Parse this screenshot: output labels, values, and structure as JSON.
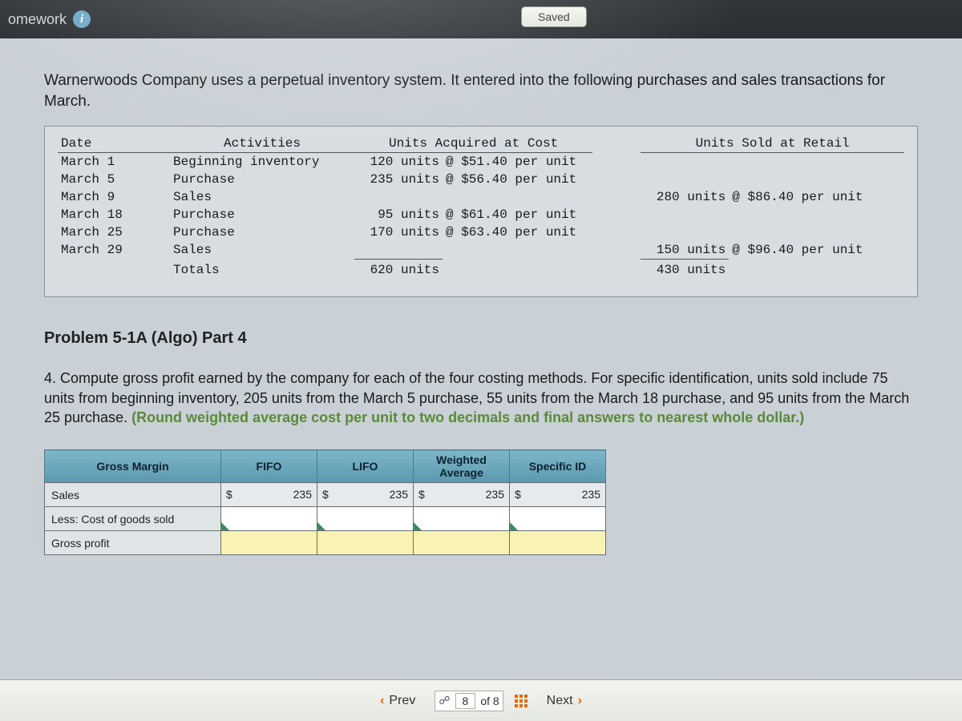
{
  "topbar": {
    "title": "omework",
    "saved": "Saved"
  },
  "intro": "Warnerwoods Company uses a perpetual inventory system. It entered into the following purchases and sales transactions for March.",
  "headers": {
    "date": "Date",
    "activities": "Activities",
    "acquired": "Units Acquired at Cost",
    "sold": "Units Sold at Retail"
  },
  "rows": [
    {
      "date": "March 1",
      "act": "Beginning inventory",
      "acq_units": "120 units",
      "acq_rate": "@ $51.40 per unit",
      "sold_units": "",
      "sold_rate": ""
    },
    {
      "date": "March 5",
      "act": "Purchase",
      "acq_units": "235 units",
      "acq_rate": "@ $56.40 per unit",
      "sold_units": "",
      "sold_rate": ""
    },
    {
      "date": "March 9",
      "act": "Sales",
      "acq_units": "",
      "acq_rate": "",
      "sold_units": "280 units",
      "sold_rate": "@ $86.40 per unit"
    },
    {
      "date": "March 18",
      "act": "Purchase",
      "acq_units": "95 units",
      "acq_rate": "@ $61.40 per unit",
      "sold_units": "",
      "sold_rate": ""
    },
    {
      "date": "March 25",
      "act": "Purchase",
      "acq_units": "170 units",
      "acq_rate": "@ $63.40 per unit",
      "sold_units": "",
      "sold_rate": ""
    },
    {
      "date": "March 29",
      "act": "Sales",
      "acq_units": "",
      "acq_rate": "",
      "sold_units": "150 units",
      "sold_rate": "@ $96.40 per unit"
    }
  ],
  "totals": {
    "label": "Totals",
    "acq": "620 units",
    "sold": "430 units"
  },
  "problem_title": "Problem 5-1A (Algo) Part 4",
  "question_lead": "4. Compute gross profit earned by the company for each of the four costing methods. For specific identification, units sold include 75 units from beginning inventory, 205 units from the March 5 purchase, 55 units from the March 18 purchase, and 95 units from the March 25 purchase. ",
  "question_bold": "(Round weighted average cost per unit to two decimals and final answers to nearest whole dollar.)",
  "answer": {
    "rowhead": "Gross Margin",
    "cols": [
      "FIFO",
      "LIFO",
      "Weighted\nAverage",
      "Specific ID"
    ],
    "rows": [
      "Sales",
      "Less: Cost of goods sold",
      "Gross profit"
    ],
    "sym": "$",
    "sales_vals": [
      "235",
      "235",
      "235",
      "235"
    ]
  },
  "nav": {
    "prev": "Prev",
    "next": "Next",
    "cur": "8",
    "of": "of 8"
  }
}
